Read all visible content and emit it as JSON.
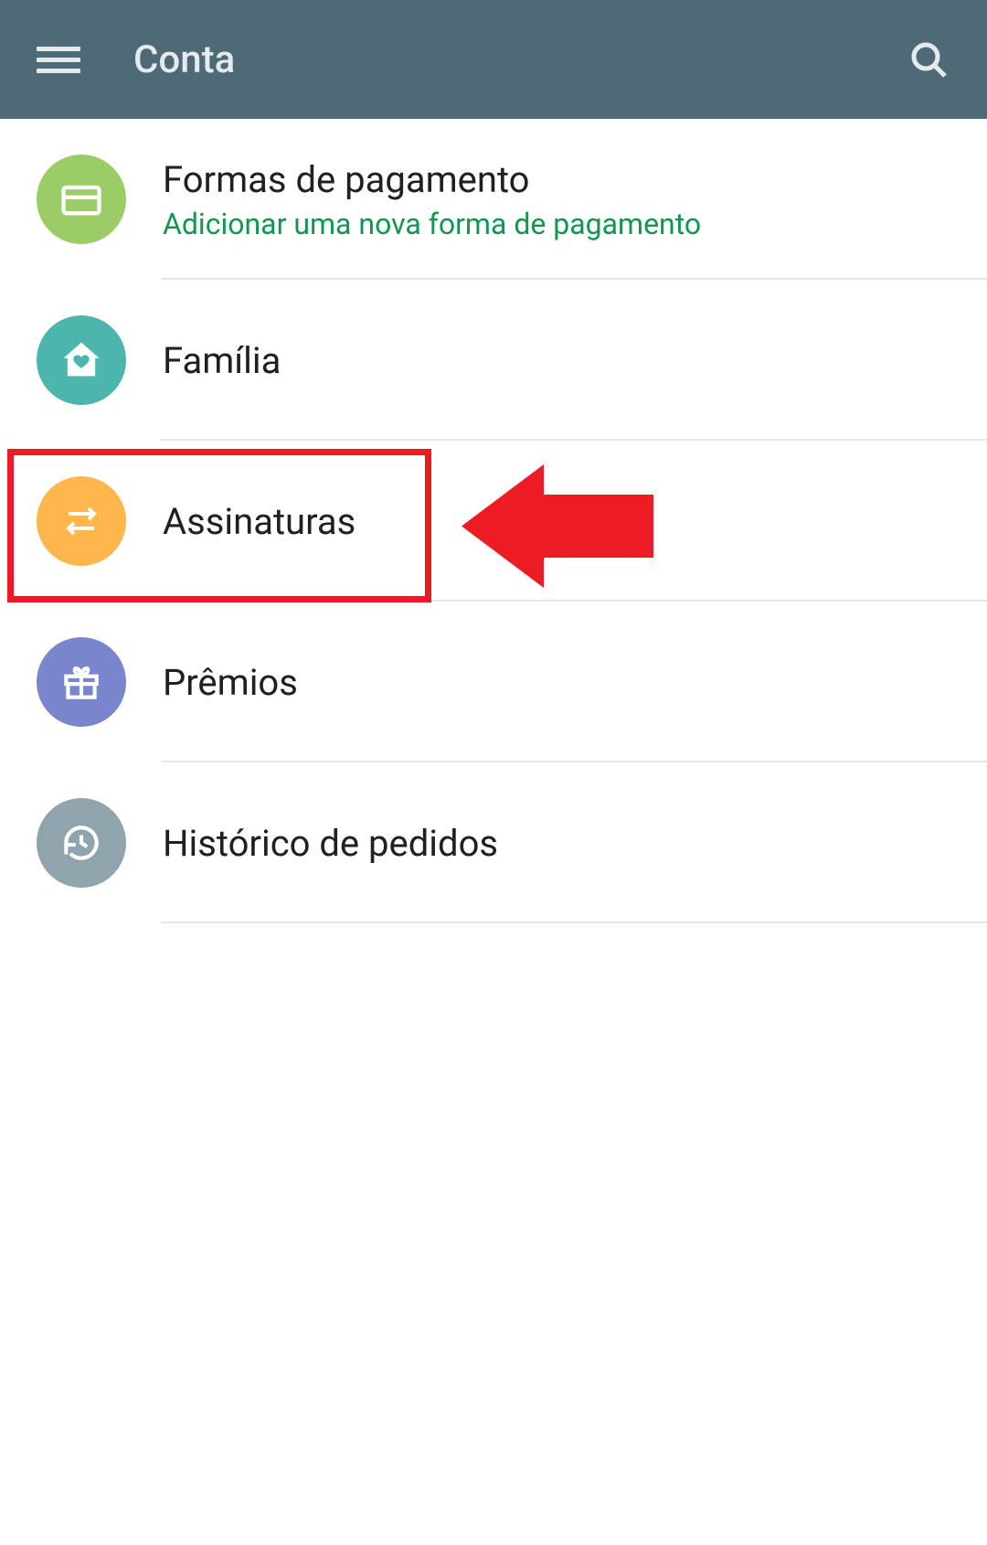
{
  "header": {
    "title": "Conta"
  },
  "items": [
    {
      "label": "Formas de pagamento",
      "sublabel": "Adicionar uma nova forma de pagamento"
    },
    {
      "label": "Família"
    },
    {
      "label": "Assinaturas"
    },
    {
      "label": "Prêmios"
    },
    {
      "label": "Histórico de pedidos"
    }
  ]
}
